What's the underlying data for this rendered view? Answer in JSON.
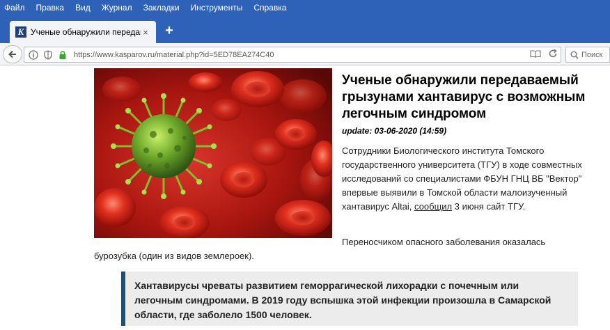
{
  "menu": [
    "Файл",
    "Правка",
    "Вид",
    "Журнал",
    "Закладки",
    "Инструменты",
    "Справка"
  ],
  "tab": {
    "title": "Ученые обнаружили передаваемый",
    "favicon": "K",
    "close": "×"
  },
  "new_tab": "+",
  "url": "https://www.kasparov.ru/material.php?id=5ED78EA274C40",
  "search": {
    "label": "Поиск"
  },
  "article": {
    "title": "Ученые обнаружили передаваемый грызунами хантавирус с возможным легочным синдромом",
    "date": "update: 03-06-2020 (14:59)",
    "lead_before_link": "Сотрудники Биологического института Томского государственного университета (ТГУ) в ходе совместных исследований со специалистами ФБУН ГНЦ ВБ \"Вектор\" впервые выявили в Томской области малоизученный хантавирус Altai, ",
    "lead_link": "сообщил",
    "lead_after_link": " 3 июня сайт ТГУ.",
    "para_start": "Переносчиком опасного заболевания оказалась",
    "para_end": "бурозубка (один из видов землероек).",
    "quote": "Хантавирусы чреваты развитием геморрагической лихорадки с почечным или легочным синдромами. В 2019 году вспышка этой инфекции произошла в Самарской области, где заболело 1500 человек."
  },
  "colors": {
    "chrome": "#2e62b9",
    "quote_border": "#1f5072",
    "quote_bg": "#ececec"
  }
}
